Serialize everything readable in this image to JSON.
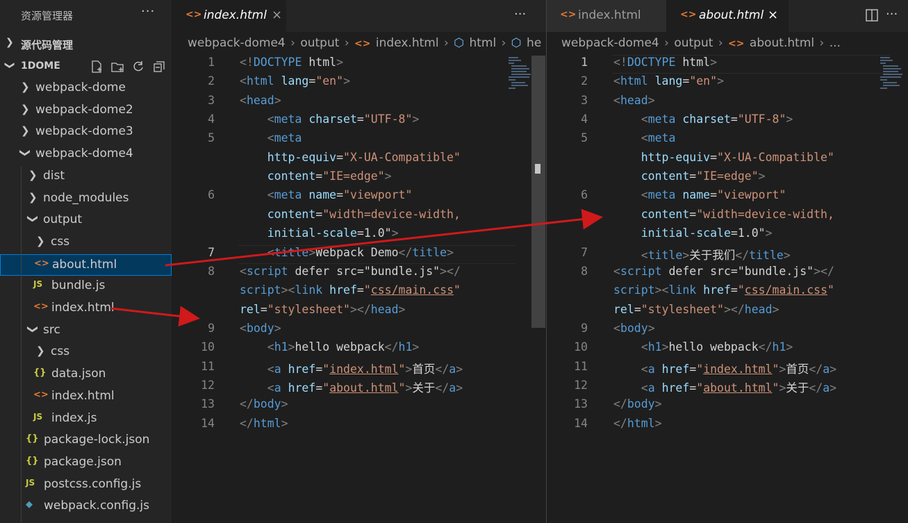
{
  "sidebar": {
    "title": "资源管理器",
    "more": "···",
    "source_control": "源代码管理",
    "workspace": "1DOME",
    "tree": [
      {
        "label": "webpack-dome",
        "type": "folder",
        "open": false,
        "depth": 0
      },
      {
        "label": "webpack-dome2",
        "type": "folder",
        "open": false,
        "depth": 0
      },
      {
        "label": "webpack-dome3",
        "type": "folder",
        "open": false,
        "depth": 0
      },
      {
        "label": "webpack-dome4",
        "type": "folder",
        "open": true,
        "depth": 0
      },
      {
        "label": "dist",
        "type": "folder",
        "open": false,
        "depth": 1
      },
      {
        "label": "node_modules",
        "type": "folder",
        "open": false,
        "depth": 1
      },
      {
        "label": "output",
        "type": "folder",
        "open": true,
        "depth": 1
      },
      {
        "label": "css",
        "type": "folder",
        "open": false,
        "depth": 2
      },
      {
        "label": "about.html",
        "type": "html",
        "depth": 2,
        "selected": true
      },
      {
        "label": "bundle.js",
        "type": "js",
        "depth": 2
      },
      {
        "label": "index.html",
        "type": "html",
        "depth": 2
      },
      {
        "label": "src",
        "type": "folder",
        "open": true,
        "depth": 1
      },
      {
        "label": "css",
        "type": "folder",
        "open": false,
        "depth": 2
      },
      {
        "label": "data.json",
        "type": "json",
        "depth": 2
      },
      {
        "label": "index.html",
        "type": "html",
        "depth": 2
      },
      {
        "label": "index.js",
        "type": "js",
        "depth": 2
      },
      {
        "label": "package-lock.json",
        "type": "json",
        "depth": 1
      },
      {
        "label": "package.json",
        "type": "json",
        "depth": 1
      },
      {
        "label": "postcss.config.js",
        "type": "js",
        "depth": 1
      },
      {
        "label": "webpack.config.js",
        "type": "webpack",
        "depth": 1
      }
    ],
    "icons": {
      "html": "<>",
      "js": "JS",
      "json": "{}",
      "webpack": "◆"
    }
  },
  "left_editor": {
    "tab": {
      "label": "index.html",
      "close": "×"
    },
    "more": "···",
    "breadcrumb": [
      "webpack-dome4",
      "output",
      "index.html",
      "html",
      "he"
    ],
    "current_line": "7",
    "lines": [
      {
        "n": "1",
        "text": "<!DOCTYPE html>"
      },
      {
        "n": "2",
        "text": "<html lang=\"en\">"
      },
      {
        "n": "3",
        "text": "<head>"
      },
      {
        "n": "4",
        "text": "    <meta charset=\"UTF-8\">"
      },
      {
        "n": "5",
        "text": "    <meta"
      },
      {
        "n": "",
        "text": "    http-equiv=\"X-UA-Compatible\""
      },
      {
        "n": "",
        "text": "    content=\"IE=edge\">"
      },
      {
        "n": "6",
        "text": "    <meta name=\"viewport\""
      },
      {
        "n": "",
        "text": "    content=\"width=device-width,"
      },
      {
        "n": "",
        "text": "    initial-scale=1.0\">"
      },
      {
        "n": "7",
        "text": "    <title>Webpack Demo</title>"
      },
      {
        "n": "8",
        "text": "<script defer src=\"bundle.js\"></"
      },
      {
        "n": "",
        "text": "script><link href=\"css/main.css\""
      },
      {
        "n": "",
        "text": "rel=\"stylesheet\"></head>"
      },
      {
        "n": "9",
        "text": "<body>"
      },
      {
        "n": "10",
        "text": "    <h1>hello webpack</h1>"
      },
      {
        "n": "11",
        "text": "    <a href=\"index.html\">首页</a>"
      },
      {
        "n": "12",
        "text": "    <a href=\"about.html\">关于</a>"
      },
      {
        "n": "13",
        "text": "</body>"
      },
      {
        "n": "14",
        "text": "</html>"
      }
    ]
  },
  "right_editor": {
    "tabs": [
      {
        "label": "index.html",
        "active": false
      },
      {
        "label": "about.html",
        "active": true,
        "close": "×"
      }
    ],
    "more": "···",
    "breadcrumb": [
      "webpack-dome4",
      "output",
      "about.html",
      "..."
    ],
    "current_line": "1",
    "lines": [
      {
        "n": "1",
        "text": "<!DOCTYPE html>"
      },
      {
        "n": "2",
        "text": "<html lang=\"en\">"
      },
      {
        "n": "3",
        "text": "<head>"
      },
      {
        "n": "4",
        "text": "    <meta charset=\"UTF-8\">"
      },
      {
        "n": "5",
        "text": "    <meta"
      },
      {
        "n": "",
        "text": "    http-equiv=\"X-UA-Compatible\""
      },
      {
        "n": "",
        "text": "    content=\"IE=edge\">"
      },
      {
        "n": "6",
        "text": "    <meta name=\"viewport\""
      },
      {
        "n": "",
        "text": "    content=\"width=device-width,"
      },
      {
        "n": "",
        "text": "    initial-scale=1.0\">"
      },
      {
        "n": "7",
        "text": "    <title>关于我们</title>"
      },
      {
        "n": "8",
        "text": "<script defer src=\"bundle.js\"></"
      },
      {
        "n": "",
        "text": "script><link href=\"css/main.css\""
      },
      {
        "n": "",
        "text": "rel=\"stylesheet\"></head>"
      },
      {
        "n": "9",
        "text": "<body>"
      },
      {
        "n": "10",
        "text": "    <h1>hello webpack</h1>"
      },
      {
        "n": "11",
        "text": "    <a href=\"index.html\">首页</a>"
      },
      {
        "n": "12",
        "text": "    <a href=\"about.html\">关于</a>"
      },
      {
        "n": "13",
        "text": "</body>"
      },
      {
        "n": "14",
        "text": "</html>"
      }
    ]
  },
  "colors": {
    "annotation_arrow": "#d0191b",
    "selection": "#04395e",
    "accent": "#007fd4"
  }
}
